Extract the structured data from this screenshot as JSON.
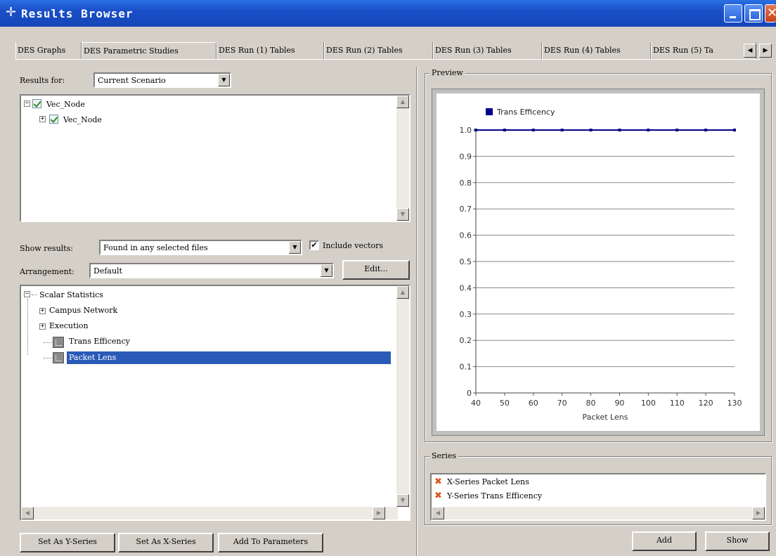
{
  "window": {
    "title": "Results Browser"
  },
  "tabs": [
    {
      "label": "DES Graphs"
    },
    {
      "label": "DES Parametric Studies",
      "active": true
    },
    {
      "label": "DES Run (1) Tables"
    },
    {
      "label": "DES Run (2) Tables"
    },
    {
      "label": "DES Run (3) Tables"
    },
    {
      "label": "DES Run (4) Tables"
    },
    {
      "label": "DES Run (5) Ta"
    }
  ],
  "results_for": {
    "label": "Results for:",
    "value": "Current Scenario"
  },
  "scenario_tree": [
    {
      "label": "Vec_Node",
      "expander": "−"
    },
    {
      "label": "Vec_Node",
      "expander": "+"
    }
  ],
  "show_results": {
    "label": "Show results:",
    "value": "Found in any selected files",
    "include_vectors_label": "Include vectors",
    "include_vectors": true
  },
  "arrangement": {
    "label": "Arrangement:",
    "value": "Default",
    "edit_label": "Edit..."
  },
  "stats_tree": {
    "root": "Scalar Statistics",
    "groups": [
      "Campus Network",
      "Execution"
    ],
    "items": [
      {
        "label": "Trans Efficency",
        "selected": false
      },
      {
        "label": "Packet Lens",
        "selected": true
      }
    ]
  },
  "bottom_buttons": {
    "set_y": "Set As Y-Series",
    "set_x": "Set As X-Series",
    "add_params": "Add To Parameters"
  },
  "preview": {
    "title": "Preview"
  },
  "series": {
    "title": "Series",
    "items": [
      "X-Series Packet Lens",
      "Y-Series Trans Efficency"
    ]
  },
  "actions": {
    "add": "Add",
    "show": "Show"
  },
  "chart_data": {
    "type": "line",
    "x": [
      40,
      50,
      60,
      70,
      80,
      90,
      100,
      110,
      120,
      130
    ],
    "series": [
      {
        "name": "Trans Efficency",
        "values": [
          1.0,
          1.0,
          1.0,
          1.0,
          1.0,
          1.0,
          1.0,
          1.0,
          1.0,
          1.0
        ],
        "color": "#00008b"
      }
    ],
    "xlabel": "Packet Lens",
    "ylabel": "",
    "xlim": [
      40,
      130
    ],
    "ylim": [
      0,
      1.0
    ],
    "xticks": [
      "40",
      "50",
      "60",
      "70",
      "80",
      "90",
      "100",
      "110",
      "120",
      "130"
    ],
    "yticks": [
      "0",
      "0.1",
      "0.2",
      "0.3",
      "0.4",
      "0.5",
      "0.6",
      "0.7",
      "0.8",
      "0.9",
      "1.0"
    ],
    "grid": "horizontal",
    "legend": "top-left"
  }
}
